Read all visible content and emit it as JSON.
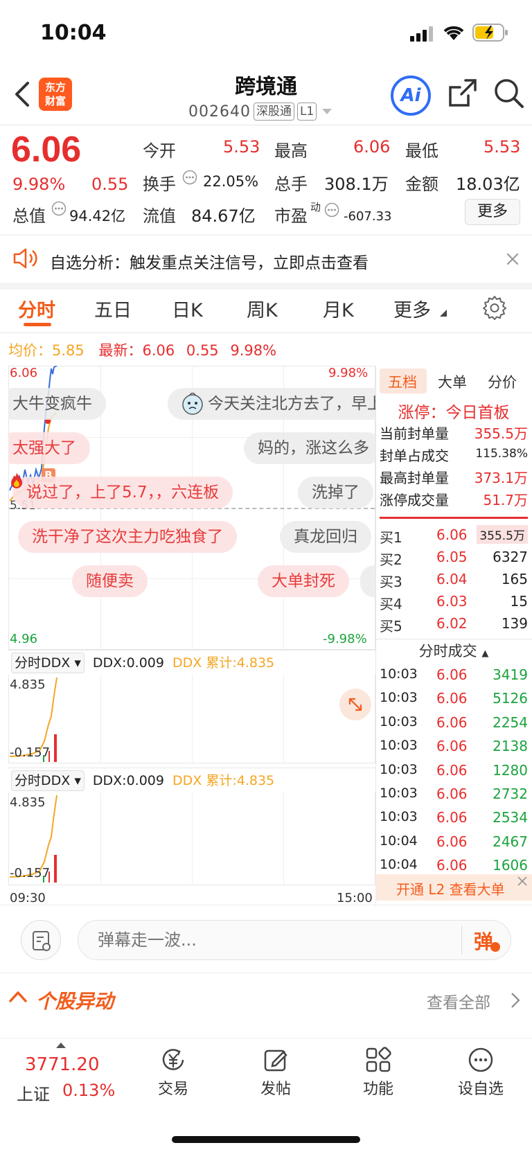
{
  "status_bar": {
    "time": "10:04"
  },
  "header": {
    "logo_line1": "东方",
    "logo_line2": "财富",
    "title": "跨境通",
    "code": "002640",
    "tag_market": "深股通",
    "tag_level": "L1",
    "ai_label": "Ai"
  },
  "quote": {
    "price": "6.06",
    "change_pct": "9.98%",
    "change": "0.55",
    "open_label": "今开",
    "open": "5.53",
    "high_label": "最高",
    "high": "6.06",
    "low_label": "最低",
    "low": "5.53",
    "turnover_label": "换手",
    "turnover": "22.05%",
    "volume_label": "总手",
    "volume": "308.1万",
    "amount_label": "金额",
    "amount": "18.03亿",
    "mktcap_label": "总值",
    "mktcap": "94.42亿",
    "float_label": "流值",
    "float": "84.67亿",
    "pe_label": "市盈",
    "pe_sup": "动",
    "pe": "-607.33",
    "more_label": "更多"
  },
  "banner": {
    "text": "自选分析：触发重点关注信号，立即点击查看"
  },
  "tabs": [
    "分时",
    "五日",
    "日K",
    "周K",
    "月K",
    "更多"
  ],
  "chart_info": {
    "avg_label": "均价：",
    "avg": "5.85",
    "latest_label": "最新：",
    "latest": "6.06",
    "latest_change": "0.55",
    "latest_pct": "9.98%",
    "y_top": "6.06",
    "y_mid": "5.51",
    "y_bottom": "4.96",
    "pct_top": "9.98%",
    "pct_bottom": "-9.98%",
    "x_start": "09:30",
    "x_end": "15:00",
    "marker": "B"
  },
  "danmu": [
    "大牛变疯牛",
    "今天关注北方去了，早上",
    "太强大了",
    "妈的，涨这么多",
    "说过了，上了5.7，，六连板",
    "洗掉了",
    "洗干净了这次主力吃独食了",
    "真龙回归",
    "随便卖",
    "大单封死"
  ],
  "ddx_panels": [
    {
      "selector": "分时DDX",
      "ddx_label": "DDX:0.009",
      "cum_label": "DDX 累计:4.835",
      "y_top": "4.835",
      "y_bottom": "-0.157"
    },
    {
      "selector": "分时DDX",
      "ddx_label": "DDX:0.009",
      "cum_label": "DDX 累计:4.835",
      "y_top": "4.835",
      "y_bottom": "-0.157"
    }
  ],
  "right_panel": {
    "tabs": [
      "五档",
      "大单",
      "分价"
    ],
    "limit_title": "涨停：今日首板",
    "stats": [
      {
        "label": "当前封单量",
        "value": "355.5万"
      },
      {
        "label": "封单占成交",
        "value": "115.38%"
      },
      {
        "label": "最高封单量",
        "value": "373.1万"
      },
      {
        "label": "涨停成交量",
        "value": "51.7万"
      }
    ],
    "bids": [
      {
        "label": "买1",
        "price": "6.06",
        "vol": "355.5万"
      },
      {
        "label": "买2",
        "price": "6.05",
        "vol": "6327"
      },
      {
        "label": "买3",
        "price": "6.04",
        "vol": "165"
      },
      {
        "label": "买4",
        "price": "6.03",
        "vol": "15"
      },
      {
        "label": "买5",
        "price": "6.02",
        "vol": "139"
      }
    ],
    "trades_title": "分时成交",
    "trades": [
      {
        "time": "10:03",
        "price": "6.06",
        "vol": "3419"
      },
      {
        "time": "10:03",
        "price": "6.06",
        "vol": "5126"
      },
      {
        "time": "10:03",
        "price": "6.06",
        "vol": "2254"
      },
      {
        "time": "10:03",
        "price": "6.06",
        "vol": "2138"
      },
      {
        "time": "10:03",
        "price": "6.06",
        "vol": "1280"
      },
      {
        "time": "10:03",
        "price": "6.06",
        "vol": "2732"
      },
      {
        "time": "10:03",
        "price": "6.06",
        "vol": "2534"
      },
      {
        "time": "10:04",
        "price": "6.06",
        "vol": "2467"
      },
      {
        "time": "10:04",
        "price": "6.06",
        "vol": "1606"
      }
    ],
    "l2_promo": "开通 L2 查看大单"
  },
  "comment": {
    "placeholder": "弹幕走一波...",
    "send_label": "弹"
  },
  "section": {
    "title": "个股异动",
    "view_all": "查看全部"
  },
  "tabbar": {
    "index_value": "3771.20",
    "index_name": "上证",
    "index_pct": "0.13%",
    "items": [
      "交易",
      "发帖",
      "功能",
      "设自选"
    ]
  },
  "colors": {
    "up": "#e62e2e",
    "down": "#1aa33c",
    "accent": "#f25c1b",
    "avg": "#f5a623"
  }
}
